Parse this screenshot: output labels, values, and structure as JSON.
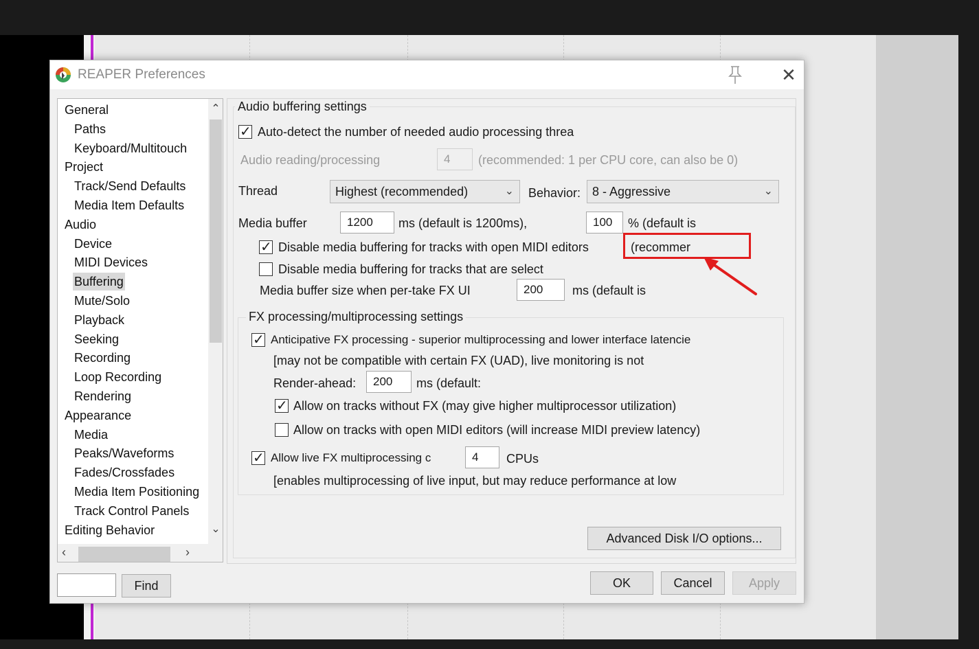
{
  "window": {
    "title": "REAPER Preferences"
  },
  "tree": {
    "items": [
      {
        "label": "General",
        "level": 0
      },
      {
        "label": "Paths",
        "level": 1
      },
      {
        "label": "Keyboard/Multitouch",
        "level": 1
      },
      {
        "label": "Project",
        "level": 0
      },
      {
        "label": "Track/Send Defaults",
        "level": 1
      },
      {
        "label": "Media Item Defaults",
        "level": 1
      },
      {
        "label": "Audio",
        "level": 0
      },
      {
        "label": "Device",
        "level": 1
      },
      {
        "label": "MIDI Devices",
        "level": 1
      },
      {
        "label": "Buffering",
        "level": 1,
        "selected": true
      },
      {
        "label": "Mute/Solo",
        "level": 1
      },
      {
        "label": "Playback",
        "level": 1
      },
      {
        "label": "Seeking",
        "level": 1
      },
      {
        "label": "Recording",
        "level": 1
      },
      {
        "label": "Loop Recording",
        "level": 1
      },
      {
        "label": "Rendering",
        "level": 1
      },
      {
        "label": "Appearance",
        "level": 0
      },
      {
        "label": "Media",
        "level": 1
      },
      {
        "label": "Peaks/Waveforms",
        "level": 1
      },
      {
        "label": "Fades/Crossfades",
        "level": 1
      },
      {
        "label": "Media Item Positioning",
        "level": 1
      },
      {
        "label": "Track Control Panels",
        "level": 1
      },
      {
        "label": "Editing Behavior",
        "level": 0
      }
    ]
  },
  "find": {
    "value": "",
    "button_label": "Find"
  },
  "audio_buffering": {
    "title": "Audio buffering settings",
    "auto_detect_label": "Auto-detect the number of needed audio processing threa",
    "auto_detect_checked": true,
    "reading_label": "Audio reading/processing",
    "reading_value": "4",
    "reading_hint": "(recommended: 1 per CPU core, can also be 0)",
    "thread_label": "Thread",
    "thread_value": "Highest (recommended)",
    "behavior_label": "Behavior:",
    "behavior_value": "8 - Aggressive",
    "media_buffer_label": "Media buffer",
    "media_buffer_value": "1200",
    "media_buffer_hint": "ms (default is 1200ms),",
    "percent_value": "100",
    "percent_hint": "% (default is",
    "disable_midi_label": "Disable media buffering for tracks with open MIDI editors",
    "disable_midi_suffix": "(recommer",
    "disable_midi_checked": true,
    "disable_selected_label": "Disable media buffering for tracks that are select",
    "disable_selected_checked": false,
    "per_take_label": "Media buffer size when per-take FX UI",
    "per_take_value": "200",
    "per_take_hint": "ms (default is"
  },
  "fx_processing": {
    "title": "FX processing/multiprocessing settings",
    "anticipative_label": "Anticipative FX processing - superior multiprocessing and lower interface latencie",
    "anticipative_checked": true,
    "compat_note": "[may not be compatible with certain FX (UAD), live monitoring is not",
    "render_ahead_label": "Render-ahead:",
    "render_ahead_value": "200",
    "render_ahead_hint": "ms (default:",
    "allow_no_fx_label": "Allow on tracks without FX (may give higher multiprocessor utilization)",
    "allow_no_fx_checked": true,
    "allow_midi_label": "Allow on tracks with open MIDI editors (will increase MIDI preview latency)",
    "allow_midi_checked": false,
    "live_fx_label": "Allow live FX multiprocessing c",
    "live_fx_checked": true,
    "live_fx_value": "4",
    "live_fx_unit": "CPUs",
    "live_fx_note": "[enables multiprocessing of live input, but may reduce performance at low"
  },
  "buttons": {
    "advanced": "Advanced Disk I/O options...",
    "ok": "OK",
    "cancel": "Cancel",
    "apply": "Apply"
  },
  "colors": {
    "highlight": "#e11d1d",
    "dialog_bg": "#f0f0f0"
  }
}
